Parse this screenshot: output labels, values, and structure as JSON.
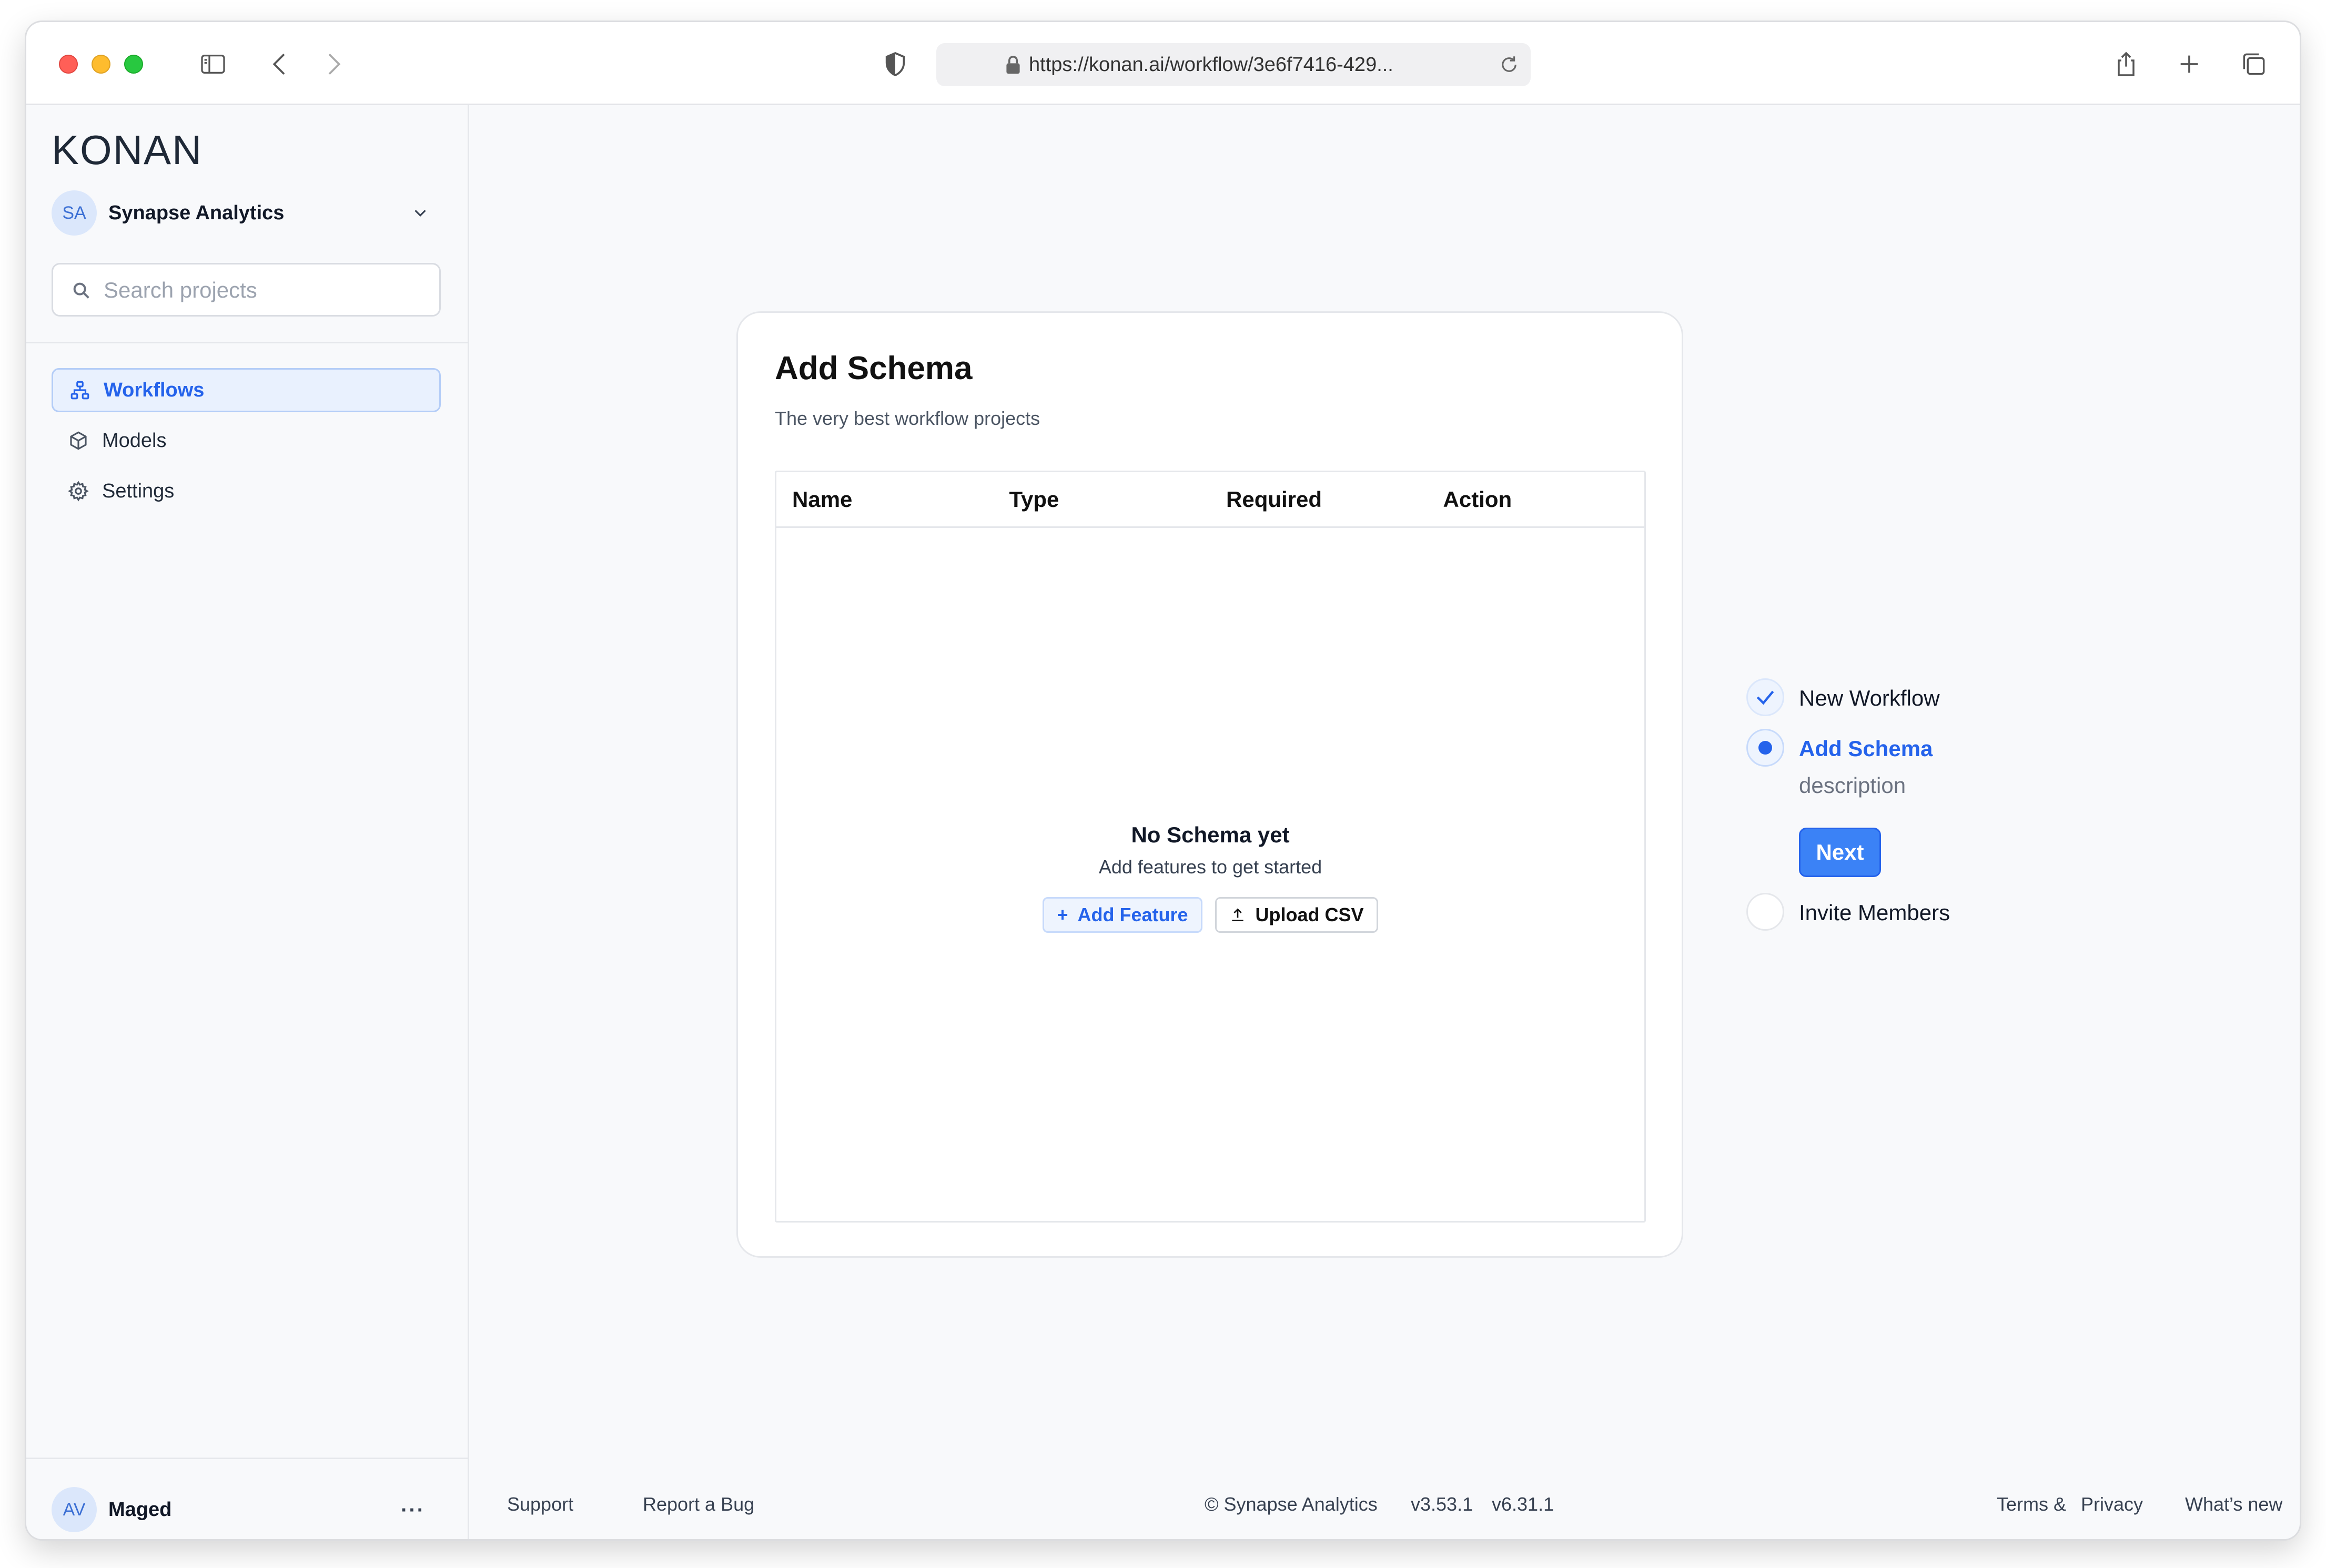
{
  "browser": {
    "url": "https://konan.ai/workflow/3e6f7416-429..."
  },
  "sidebar": {
    "logo": "KONAN",
    "org": {
      "initials": "SA",
      "name": "Synapse Analytics"
    },
    "search_placeholder": "Search projects",
    "nav": [
      {
        "label": "Workflows",
        "icon": "workflow-icon",
        "active": true
      },
      {
        "label": "Models",
        "icon": "cube-icon",
        "active": false
      },
      {
        "label": "Settings",
        "icon": "gear-icon",
        "active": false
      }
    ],
    "user": {
      "initials": "AV",
      "name": "Maged",
      "more": "···"
    }
  },
  "card": {
    "title": "Add Schema",
    "subtitle": "The very best workflow projects",
    "columns": [
      "Name",
      "Type",
      "Required",
      "Action"
    ],
    "empty_title": "No Schema yet",
    "empty_sub": "Add features to get started",
    "add_feature": "Add Feature",
    "upload_csv": "Upload CSV"
  },
  "stepper": {
    "steps": [
      {
        "label": "New Workflow",
        "state": "done"
      },
      {
        "label": "Add Schema",
        "state": "current",
        "description": "description"
      },
      {
        "label": "Invite Members",
        "state": "pending"
      }
    ],
    "next_label": "Next"
  },
  "footer": {
    "support": "Support",
    "report_bug": "Report a Bug",
    "copyright": "© Synapse Analytics",
    "version1": "v3.53.1",
    "version2": "v6.31.1",
    "terms": "Terms &",
    "privacy": "Privacy",
    "whats_new": "What’s new"
  },
  "colors": {
    "accent": "#2563eb",
    "primary_button": "#3b82f6",
    "background": "#f8f9fb"
  }
}
